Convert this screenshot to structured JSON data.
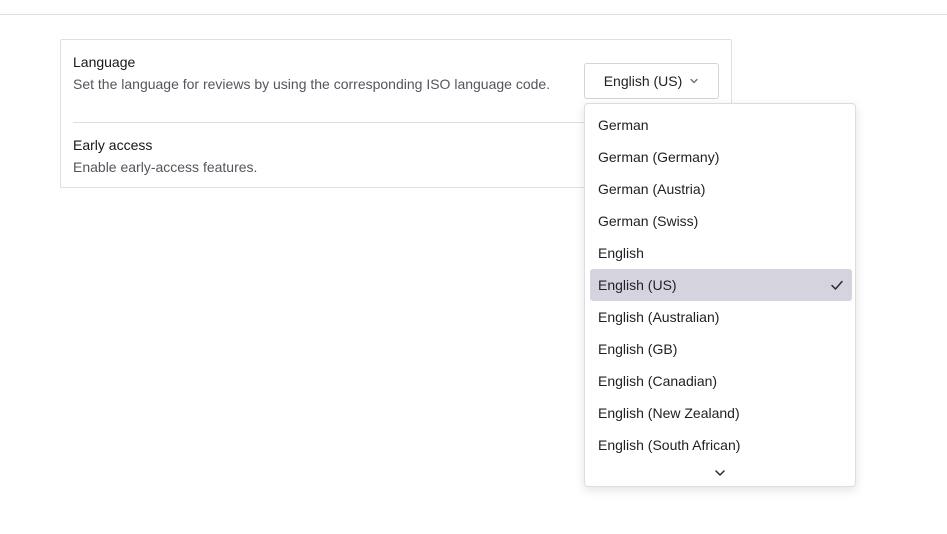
{
  "settings": {
    "language": {
      "title": "Language",
      "description": "Set the language for reviews by using the corresponding ISO language code.",
      "selected_value": "English (US)"
    },
    "early_access": {
      "title": "Early access",
      "description": "Enable early-access features."
    }
  },
  "dropdown": {
    "options": [
      {
        "label": "German",
        "selected": false
      },
      {
        "label": "German (Germany)",
        "selected": false
      },
      {
        "label": "German (Austria)",
        "selected": false
      },
      {
        "label": "German (Swiss)",
        "selected": false
      },
      {
        "label": "English",
        "selected": false
      },
      {
        "label": "English (US)",
        "selected": true
      },
      {
        "label": "English (Australian)",
        "selected": false
      },
      {
        "label": "English (GB)",
        "selected": false
      },
      {
        "label": "English (Canadian)",
        "selected": false
      },
      {
        "label": "English (New Zealand)",
        "selected": false
      },
      {
        "label": "English (South African)",
        "selected": false
      }
    ],
    "selected_highlight_color": "#d5d4de",
    "icons": {
      "check": "check-icon",
      "scroll": "chevron-down-icon"
    }
  }
}
